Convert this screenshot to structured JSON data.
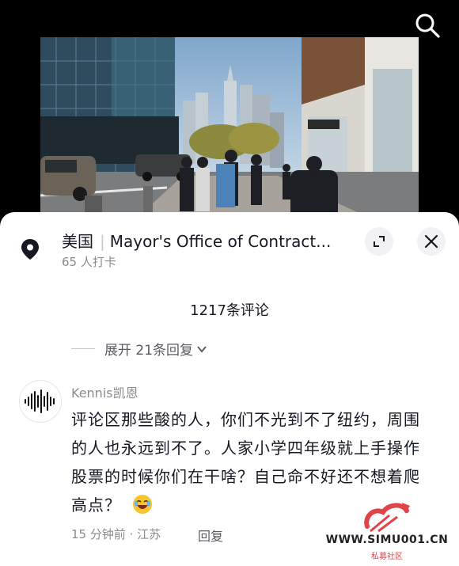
{
  "search": {
    "icon": "search-icon"
  },
  "location": {
    "country": "美国",
    "place": "Mayor's Office of Contract...",
    "checkins": "65 人打卡"
  },
  "comments": {
    "count_label": "1217条评论",
    "expand_replies_label": "展开 21条回复"
  },
  "comment": {
    "username": "Kennis凯恩",
    "text": "评论区那些酸的人，你们不光到不了纽约，周围的人也永远到不了。人家小学四年级就上手操作股票的时候你们在干啥？自己命不好还不想着爬高点？",
    "time": "15 分钟前 · 江苏",
    "reply_label": "回复"
  },
  "watermark": {
    "site": "WWW.SIMU001.CN",
    "sub": "私募社区"
  },
  "colors": {
    "accent_red": "#e0434a",
    "text_primary": "#161823",
    "text_secondary": "#8a8b91"
  }
}
